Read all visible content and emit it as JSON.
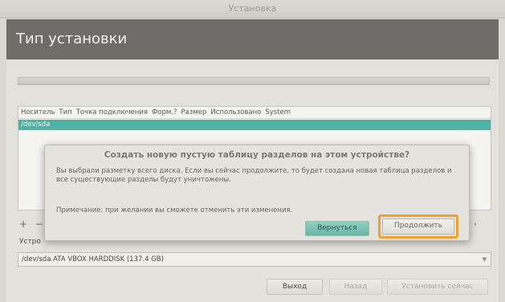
{
  "window": {
    "title": "Установка"
  },
  "header": {
    "title": "Тип установки"
  },
  "table": {
    "columns": [
      "Носитель",
      "Тип",
      "Точка подключения",
      "Форм.?",
      "Размер",
      "Использовано",
      "System"
    ],
    "rows": [
      {
        "device": "/dev/sda"
      }
    ]
  },
  "toolbar": {
    "add": "+",
    "remove": "−",
    "change": "›"
  },
  "device_label": "Устро",
  "device_select": {
    "value": "/dev/sda ATA VBOX HARDDISK (137.4 GB)"
  },
  "buttons": {
    "quit": "Выход",
    "back": "Назад",
    "install": "Установить сейчас"
  },
  "dialog": {
    "title": "Создать новую пустую таблицу разделов на этом устройстве?",
    "body": "Вы выбрали разметку всего диска. Если вы сейчас продолжите, то будет создана новая таблица разделов и все существующие разделы будут уничтожены.",
    "note": "Примечание: при желании вы сможете отменить эти изменения.",
    "back_label": "Вернуться",
    "continue_label": "Продолжить"
  },
  "colors": {
    "accent": "#4fb3a3",
    "highlight": "#f0a030",
    "banner": "#6e6d69"
  }
}
